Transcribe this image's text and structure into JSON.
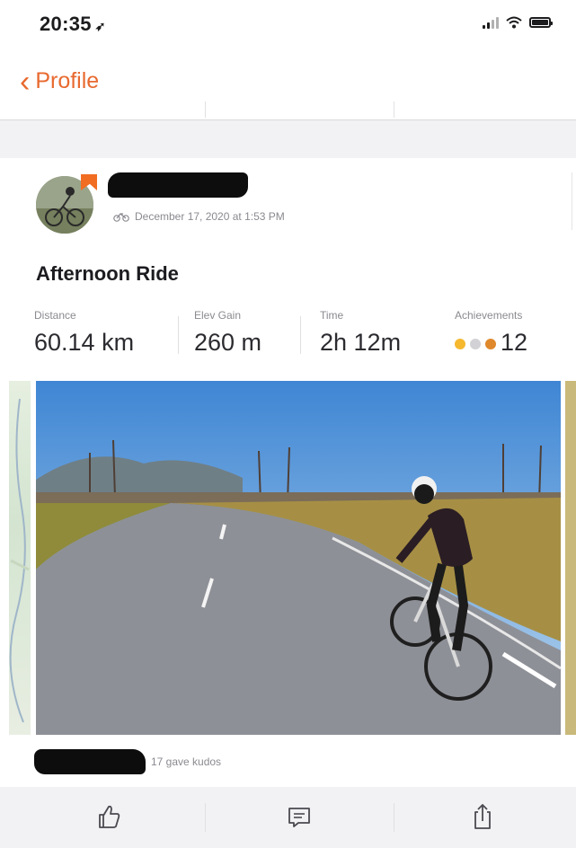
{
  "status_bar": {
    "time": "20:35",
    "location_icon": "location-arrow-icon",
    "icons": [
      "signal-icon",
      "wifi-icon",
      "battery-icon"
    ]
  },
  "nav": {
    "back_label": "Profile",
    "back_icon": "chevron-left-icon"
  },
  "activity": {
    "date": "December 17, 2020 at 1:53 PM",
    "activity_icon": "bike-icon",
    "title": "Afternoon Ride",
    "stats": [
      {
        "label": "Distance",
        "value": "60.14 km"
      },
      {
        "label": "Elev Gain",
        "value": "260 m"
      },
      {
        "label": "Time",
        "value": "2h 12m"
      },
      {
        "label": "Achievements",
        "value": "12"
      }
    ],
    "kudos_text": "17 gave kudos"
  },
  "actions": [
    {
      "name": "kudos-button",
      "icon": "thumbs-up-icon"
    },
    {
      "name": "comment-button",
      "icon": "comment-icon"
    },
    {
      "name": "share-button",
      "icon": "share-icon"
    }
  ],
  "colors": {
    "accent": "#e8692f",
    "brand_orange": "#f16d22",
    "gold_medal": "#f5b82e",
    "silver_medal": "#d2d2d6",
    "bronze_medal": "#e0882c"
  }
}
